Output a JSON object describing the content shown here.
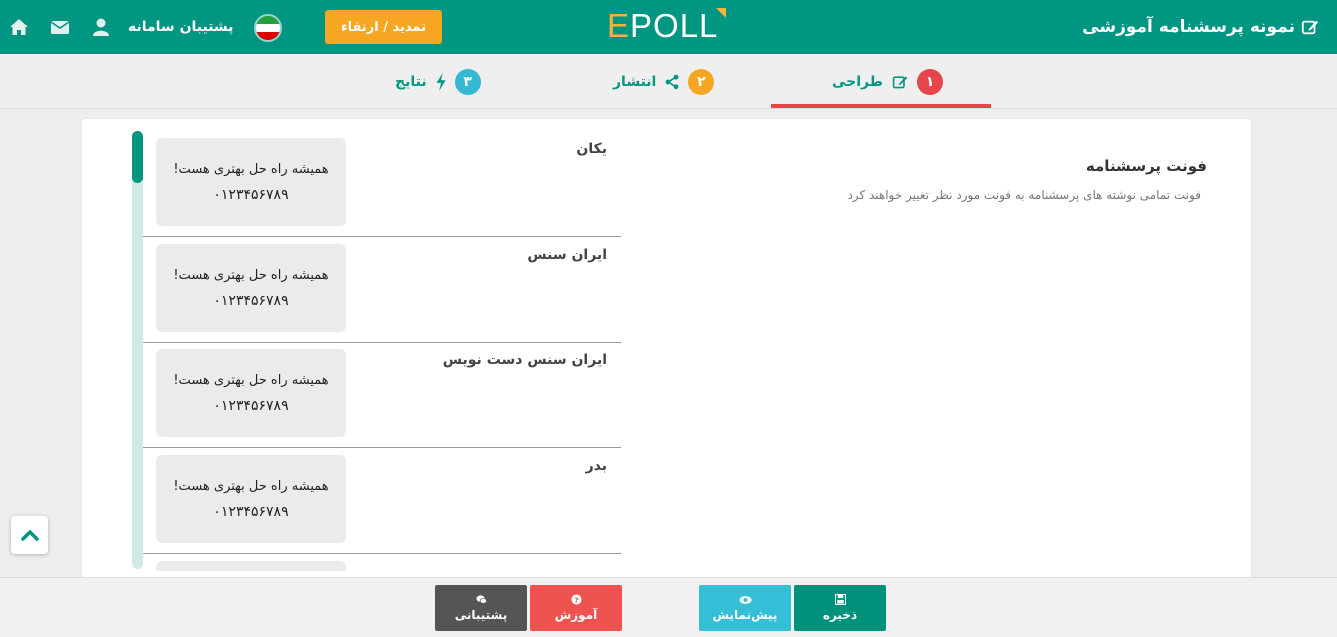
{
  "header": {
    "title": "نمونه پرسشنامه آموزشی",
    "logo_first": "E",
    "logo_rest": "POLL",
    "upgrade_label": "تمدید / ارتقاء",
    "support_label": "پشتیبان سامانه",
    "icons": [
      "edit-icon",
      "flag-icon",
      "user-icon",
      "mail-icon",
      "home-icon"
    ]
  },
  "tabs": [
    {
      "number": "۱",
      "label": "طراحی",
      "icon": "edit-icon",
      "color": "#e6454a",
      "active": true
    },
    {
      "number": "۲",
      "label": "انتشار",
      "icon": "share-icon",
      "color": "#f6a623",
      "active": false
    },
    {
      "number": "۳",
      "label": "نتایج",
      "icon": "bolt-icon",
      "color": "#35b8d1",
      "active": false
    }
  ],
  "setting": {
    "title": "فونت پرسشنامه",
    "description": "فونت تمامی نوشته های پرسشنامه به فونت مورد نظر تغییر خواهند کرد"
  },
  "fonts": [
    {
      "name": "یکان",
      "sample_text": "همیشه راه حل بهتری هست!",
      "sample_digits": "۰۱۲۳۴۵۶۷۸۹"
    },
    {
      "name": "ایران سنس",
      "sample_text": "همیشه راه حل بهتری هست!",
      "sample_digits": "۰۱۲۳۴۵۶۷۸۹"
    },
    {
      "name": "ایران سنس دست نویس",
      "sample_text": "همیشه راه حل بهتری هست!",
      "sample_digits": "۰۱۲۳۴۵۶۷۸۹"
    },
    {
      "name": "بدر",
      "sample_text": "همیشه راه حل بهتری هست!",
      "sample_digits": "۰۱۲۳۴۵۶۷۸۹"
    }
  ],
  "footer": {
    "support_label": "پشتیبانی",
    "tutorial_label": "آموزش",
    "preview_label": "پیش‌نمایش",
    "save_label": "ذخیره",
    "colors": {
      "support": "#555555",
      "tutorial": "#ef5350",
      "preview": "#35bfd6",
      "save": "#00917d"
    }
  },
  "colors": {
    "primary": "#009682",
    "accent": "#f6a623",
    "active_tab": "#e6454a"
  }
}
